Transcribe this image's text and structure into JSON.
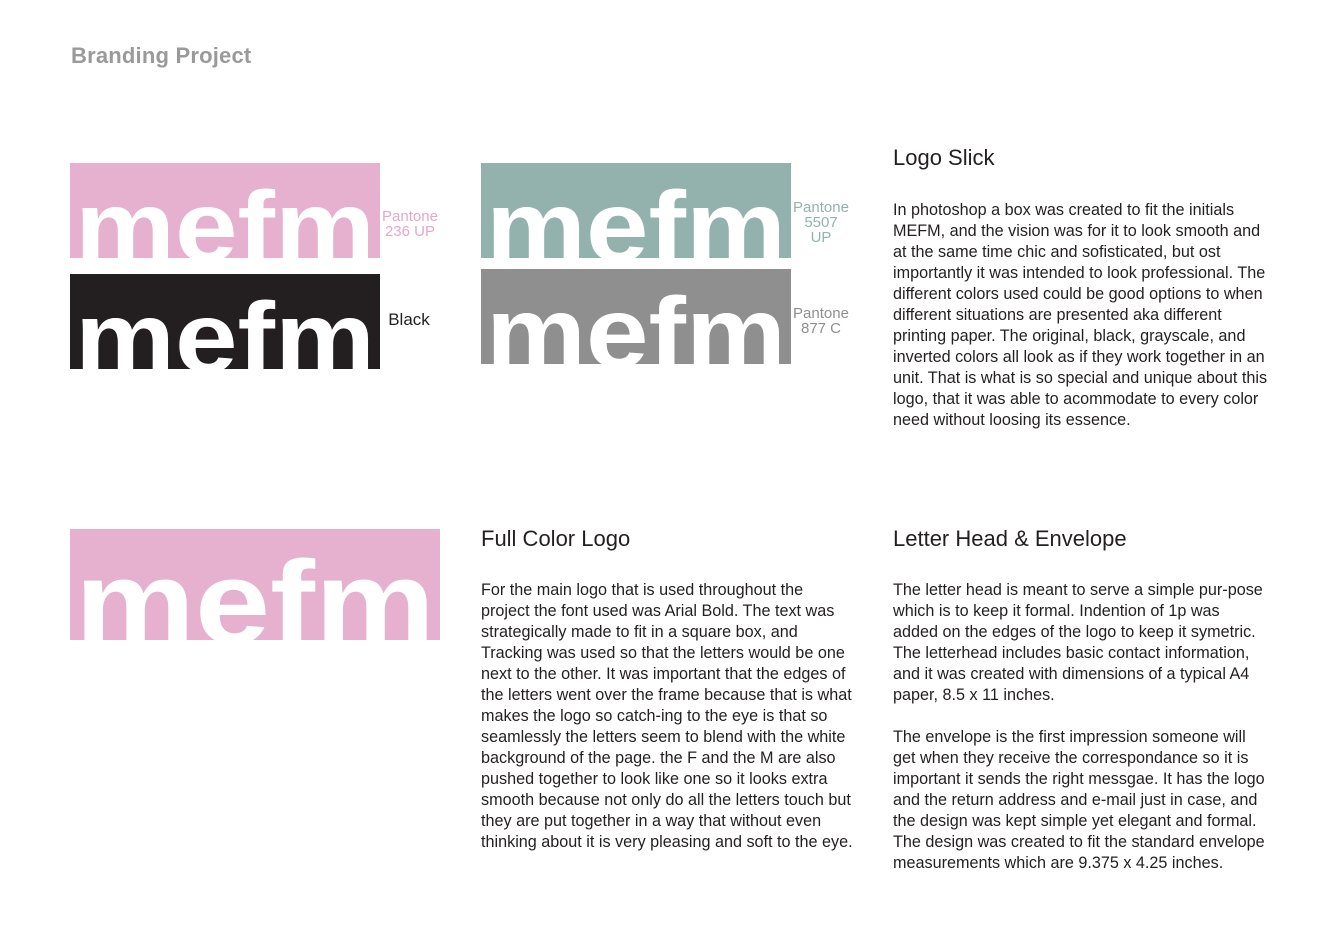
{
  "page": {
    "title": "Branding Project"
  },
  "logos": {
    "wordmark": "mefm",
    "variants": [
      {
        "id": "pink",
        "color": "#e6b0cf",
        "swatch_lines": [
          "Pantone",
          "236 UP"
        ],
        "swatch_color": "#e6a7cb"
      },
      {
        "id": "black",
        "color": "#231f20",
        "swatch_lines": [
          "Black"
        ],
        "swatch_color": "#231f20"
      },
      {
        "id": "teal",
        "color": "#94b2ad",
        "swatch_lines": [
          "Pantone",
          "5507",
          "UP"
        ],
        "swatch_color": "#94b2ad"
      },
      {
        "id": "gray",
        "color": "#8f8f8f",
        "swatch_lines": [
          "Pantone",
          "877 C"
        ],
        "swatch_color": "#8f8f8f"
      },
      {
        "id": "full-color",
        "color": "#e6b0cf"
      }
    ]
  },
  "sections": {
    "logo_slick": {
      "heading": "Logo Slick",
      "paragraphs": [
        "In photoshop a box was created to fit the initials MEFM, and the vision was for it to look smooth and at the same time chic and sofisticated, but ost importantly it was intended to look professional. The different colors used could be good options to when different situations are presented aka different printing paper. The original, black, grayscale, and inverted colors all look as if they work together in an unit. That is what is so special and unique about this logo, that it was able to acommodate to every color need without loosing its essence."
      ]
    },
    "full_color_logo": {
      "heading": "Full Color Logo",
      "paragraphs": [
        "For the main logo that is used throughout the project the font used was Arial Bold. The text was strategically made to fit in a square box, and Tracking was used so that the letters would be one next to the other. It was important that the edges of the letters went over the frame because that is what makes the logo so catch-ing to the eye is that so seamlessly the letters seem to blend with the white background of the page. the F and the M are also pushed together to look like one so it looks extra smooth because not only do all the letters touch but they are put together in a way that without even thinking about it is very pleasing and soft to the eye."
      ]
    },
    "letter_head": {
      "heading": "Letter Head & Envelope",
      "paragraphs": [
        "The letter head is meant to serve a simple pur-pose which is to keep it formal. Indention of 1p was added on the edges of the logo to keep it symetric. The letterhead includes basic contact information, and it was created with dimensions of a typical A4 paper, 8.5 x 11 inches.",
        "The envelope is the first impression someone will get when they receive the correspondance so it is important it sends the right messgae. It has the logo and the return address and e-mail just in case, and the design was kept simple yet elegant and formal. The design was created to fit the standard envelope measurements which are 9.375 x 4.25 inches."
      ]
    }
  }
}
